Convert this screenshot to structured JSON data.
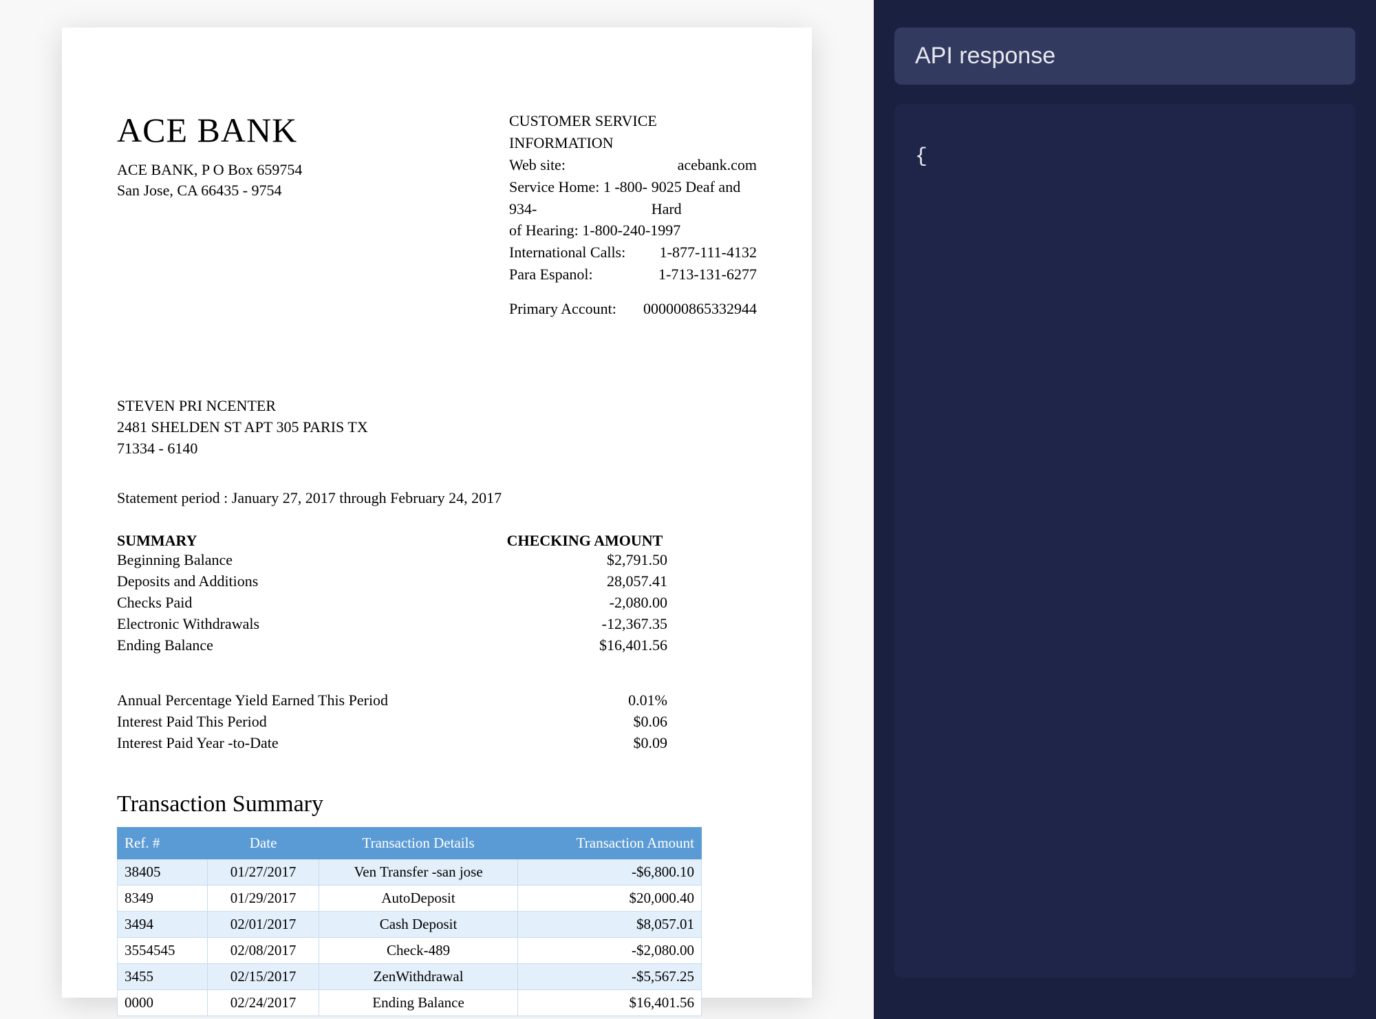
{
  "document": {
    "bank": {
      "name": "ACE BANK",
      "addr1": "ACE BANK, P O Box 659754",
      "addr2": "San Jose, CA 66435 - 9754"
    },
    "customer_service": {
      "title": "CUSTOMER SERVICE INFORMATION",
      "web_label": "Web site:",
      "web_value": "acebank.com",
      "service_home_label": "Service Home: 1 -800-934-",
      "service_home_value": "9025 Deaf and Hard",
      "hearing_line": "of Hearing: 1-800-240-1997",
      "intl_label": "International Calls:",
      "intl_value": "1-877-111-4132",
      "espanol_label": "Para Espanol:",
      "espanol_value": "1-713-131-6277",
      "primary_acct_label": "Primary Account:",
      "primary_acct_value": "000000865332944"
    },
    "recipient": {
      "name": "STEVEN PRI NCENTER",
      "addr1": "2481 SHELDEN ST APT 305 PARIS TX",
      "addr2": "71334 - 6140"
    },
    "statement_period": "Statement period  : January 27, 2017 through February 24, 2017",
    "summary": {
      "header_left": "SUMMARY",
      "header_right": "CHECKING AMOUNT",
      "rows": [
        {
          "label": "Beginning Balance",
          "value": "$2,791.50"
        },
        {
          "label": "Deposits and Additions",
          "value": "28,057.41"
        },
        {
          "label": "Checks Paid",
          "value": "-2,080.00"
        },
        {
          "label": "Electronic Withdrawals",
          "value": "-12,367.35"
        },
        {
          "label": "Ending Balance",
          "value": "$16,401.56"
        }
      ],
      "rows2": [
        {
          "label": "Annual Percentage Yield Earned This Period",
          "value": "0.01%"
        },
        {
          "label": "Interest Paid This Period",
          "value": "$0.06"
        },
        {
          "label": "Interest Paid Year -to-Date",
          "value": "$0.09"
        }
      ]
    },
    "transactions": {
      "title": "Transaction Summary",
      "headers": {
        "ref": "Ref. #",
        "date": "Date",
        "details": "Transaction Details",
        "amount": "Transaction Amount"
      },
      "rows": [
        {
          "ref": "38405",
          "date": "01/27/2017",
          "details": "Ven Transfer -san jose",
          "amount": "-$6,800.10"
        },
        {
          "ref": "8349",
          "date": "01/29/2017",
          "details": "AutoDeposit",
          "amount": "$20,000.40"
        },
        {
          "ref": "3494",
          "date": "02/01/2017",
          "details": "Cash Deposit",
          "amount": "$8,057.01"
        },
        {
          "ref": "3554545",
          "date": "02/08/2017",
          "details": "Check-489",
          "amount": "-$2,080.00"
        },
        {
          "ref": "3455",
          "date": "02/15/2017",
          "details": "ZenWithdrawal",
          "amount": "-$5,567.25"
        },
        {
          "ref": "0000",
          "date": "02/24/2017",
          "details": "Ending Balance",
          "amount": "$16,401.56"
        }
      ]
    }
  },
  "api_panel": {
    "title": "API response",
    "body": "{"
  }
}
